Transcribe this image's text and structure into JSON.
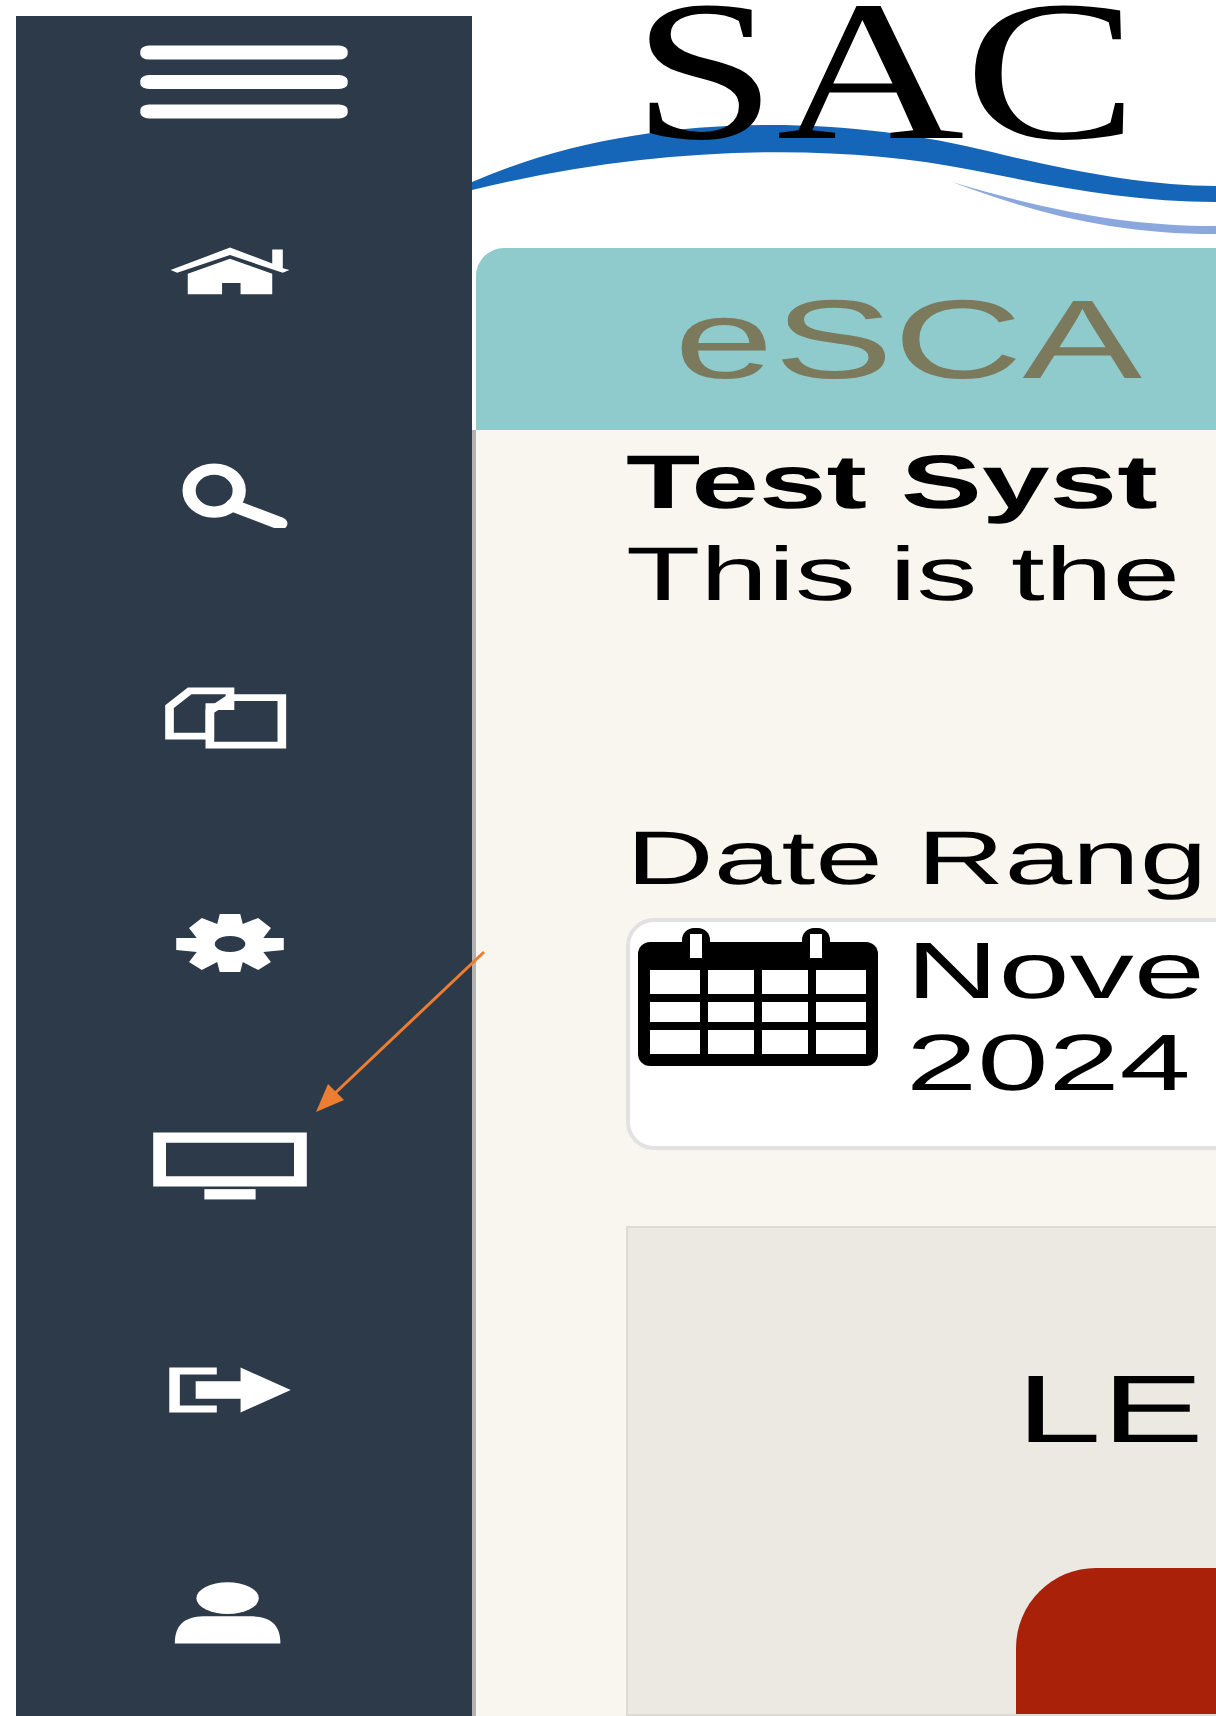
{
  "sidebar": {
    "items": [
      {
        "kind": "menu"
      },
      {
        "kind": "home"
      },
      {
        "kind": "search"
      },
      {
        "kind": "copy"
      },
      {
        "kind": "gear"
      },
      {
        "kind": "monitor"
      },
      {
        "kind": "signout"
      },
      {
        "kind": "user"
      }
    ]
  },
  "logo": {
    "text": "SAC"
  },
  "banner": {
    "title": "eSCA"
  },
  "notice": {
    "heading": "Test Syst",
    "text": "This is the"
  },
  "date_range": {
    "label": "Date Rang",
    "value_lines": [
      "Nove",
      "2024"
    ]
  },
  "panel": {
    "title": "LE"
  },
  "annotation": {
    "kind": "arrow"
  }
}
